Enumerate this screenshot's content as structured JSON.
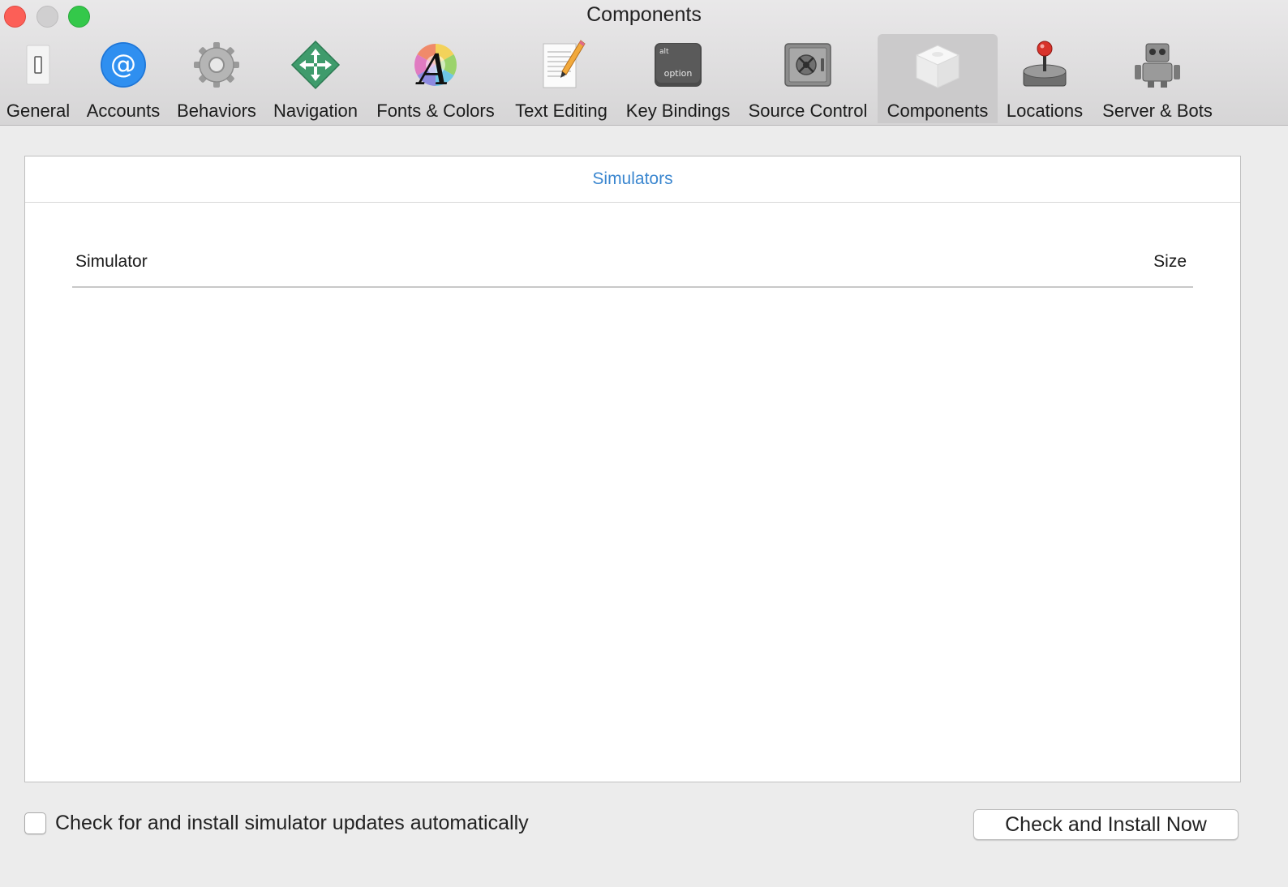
{
  "window": {
    "title": "Components"
  },
  "toolbar": {
    "items": [
      {
        "label": "General",
        "icon": "light-switch-icon"
      },
      {
        "label": "Accounts",
        "icon": "at-sign-icon"
      },
      {
        "label": "Behaviors",
        "icon": "gear-icon"
      },
      {
        "label": "Navigation",
        "icon": "navigation-arrows-icon"
      },
      {
        "label": "Fonts & Colors",
        "icon": "font-color-wheel-icon"
      },
      {
        "label": "Text Editing",
        "icon": "document-pencil-icon"
      },
      {
        "label": "Key Bindings",
        "icon": "option-key-icon",
        "key_top": "alt",
        "key_bottom": "option"
      },
      {
        "label": "Source Control",
        "icon": "safe-icon"
      },
      {
        "label": "Components",
        "icon": "component-box-icon",
        "selected": true
      },
      {
        "label": "Locations",
        "icon": "joystick-icon"
      },
      {
        "label": "Server & Bots",
        "icon": "robot-icon"
      }
    ]
  },
  "panel": {
    "tab_label": "Simulators",
    "table": {
      "columns": [
        "Simulator",
        "Size"
      ],
      "rows": []
    }
  },
  "footer": {
    "auto_update": {
      "label": "Check for and install simulator updates automatically",
      "checked": false
    },
    "install_button_label": "Check and Install Now"
  },
  "colors": {
    "accent": "#3a86cf",
    "close": "#fc5f57",
    "minimize": "#d0cfd0",
    "zoom": "#34c84a"
  }
}
